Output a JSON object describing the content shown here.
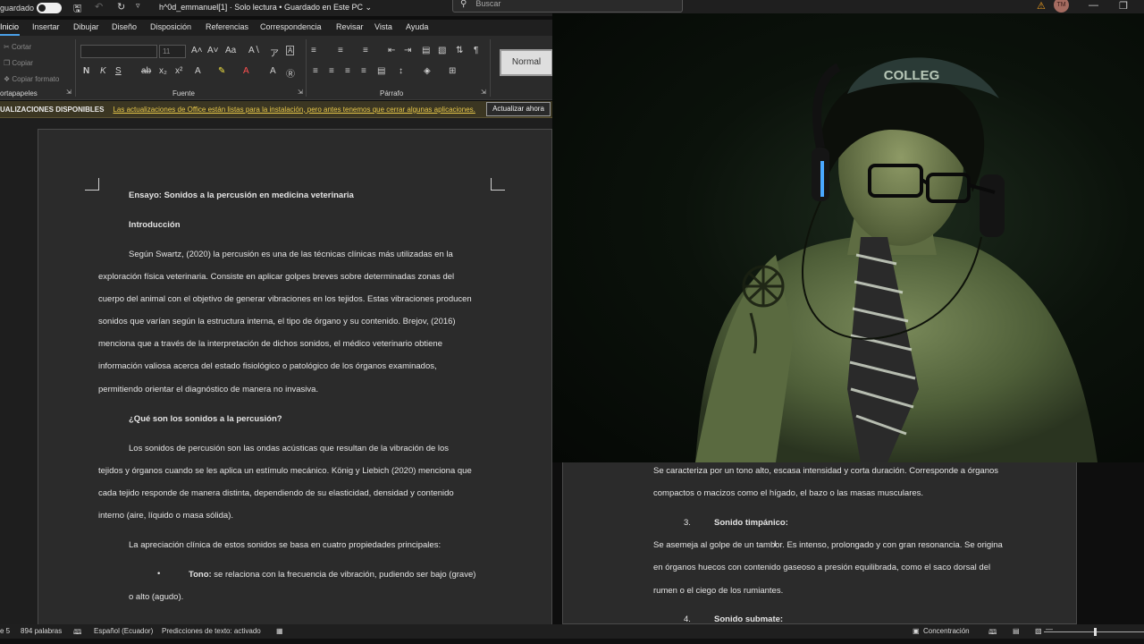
{
  "titlebar": {
    "autosave_label": "guardado",
    "doc_title": "h^0d_emmanuel[1] · Solo lectura • Guardado en Este PC ⌄",
    "search_placeholder": "Buscar",
    "avatar_initials": "TM"
  },
  "menu": {
    "tabs": [
      "Inicio",
      "Insertar",
      "Dibujar",
      "Diseño",
      "Disposición",
      "Referencias",
      "Correspondencia",
      "Revisar",
      "Vista",
      "Ayuda"
    ]
  },
  "ribbon": {
    "clipboard": {
      "cut": "Cortar",
      "copy": "Copiar",
      "format_painter": "Copiar formato",
      "label": "ortapapeles"
    },
    "font": {
      "size": "11",
      "label": "Fuente"
    },
    "paragraph": {
      "label": "Párrafo"
    },
    "styles": {
      "normal": "Normal"
    }
  },
  "banner": {
    "title": "UALIZACIONES DISPONIBLES",
    "message": "Las actualizaciones de Office están listas para la instalación, pero antes tenemos que cerrar algunas aplicaciones.",
    "button": "Actualizar ahora"
  },
  "document": {
    "title": "Ensayo: Sonidos a la percusión en medicina veterinaria",
    "heading_intro": "Introducción",
    "intro_lines": [
      "Según Swartz, (2020) la percusión es una de las técnicas clínicas más utilizadas en la",
      "exploración física veterinaria. Consiste en aplicar golpes breves sobre determinadas zonas del",
      "cuerpo del animal con el objetivo de generar vibraciones en los tejidos. Estas vibraciones producen",
      "sonidos que varían según la estructura interna, el tipo de órgano y su contenido. Brejov, (2016)",
      "menciona que  a través de la interpretación de dichos sonidos, el médico veterinario obtiene",
      "información valiosa acerca del estado fisiológico o patológico de los órganos examinados,",
      "permitiendo orientar el diagnóstico de manera no invasiva."
    ],
    "heading_what": "¿Qué son los sonidos a la percusión?",
    "what_lines": [
      "Los sonidos de percusión son las ondas acústicas que resultan de la vibración de los",
      "tejidos y órganos cuando se les aplica un estímulo mecánico. König y Liebich (2020) menciona que",
      "cada tejido responde de manera distinta, dependiendo de su elasticidad, densidad y contenido",
      "interno (aire, líquido o masa sólida)."
    ],
    "appreciation_line": "La apreciación clínica de estos sonidos se basa en cuatro propiedades principales:",
    "bullet_label": "Tono:",
    "bullet_text": " se relaciona con la frecuencia de vibración, pudiendo ser bajo (grave)",
    "bullet_cont": "o alto (agudo)."
  },
  "document2": {
    "lines_a": [
      "Se caracteriza por un tono alto, escasa intensidad y corta duración. Corresponde a órganos",
      "compactos o macizos como el hígado, el bazo o las masas musculares."
    ],
    "item3_num": "3.",
    "item3_title": "Sonido timpánico:",
    "lines_b": [
      "Se asemeja al golpe de un tambor. Es intenso, prolongado y con gran resonancia. Se origina",
      "en órganos huecos con contenido gaseoso a presión equilibrada, como el saco dorsal del",
      "rumen o el ciego de los rumiantes."
    ],
    "item4_num": "4.",
    "item4_title": "Sonido submate:"
  },
  "status": {
    "page": "e 5",
    "words": "894 palabras",
    "language": "Español (Ecuador)",
    "predictions": "Predicciones de texto: activado",
    "focus": "Concentración"
  },
  "webcam": {
    "cap_text": "COLLEG"
  }
}
